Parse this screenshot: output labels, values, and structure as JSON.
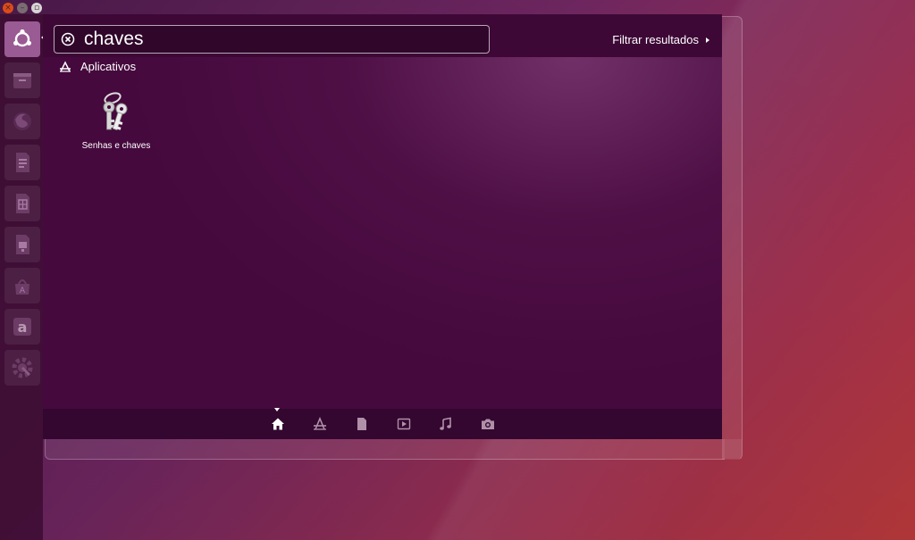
{
  "search": {
    "query": "chaves"
  },
  "filter": {
    "label": "Filtrar resultados"
  },
  "section": {
    "title": "Aplicativos"
  },
  "results": [
    {
      "label": "Senhas e chaves",
      "icon": "keys-icon"
    }
  ],
  "launcher": {
    "items": [
      {
        "icon": "ubuntu-logo-icon",
        "active": true
      },
      {
        "icon": "files-icon"
      },
      {
        "icon": "firefox-icon"
      },
      {
        "icon": "writer-icon"
      },
      {
        "icon": "calc-icon"
      },
      {
        "icon": "impress-icon"
      },
      {
        "icon": "software-center-icon"
      },
      {
        "icon": "amazon-icon"
      },
      {
        "icon": "system-settings-icon"
      }
    ]
  },
  "lenses": [
    {
      "icon": "home-icon",
      "active": true
    },
    {
      "icon": "applications-icon"
    },
    {
      "icon": "files-lens-icon"
    },
    {
      "icon": "video-icon"
    },
    {
      "icon": "music-icon"
    },
    {
      "icon": "photos-icon"
    }
  ],
  "colors": {
    "dash_bg": "#45093d",
    "launcher_bg": "#3c0c32",
    "active_launcher": "#9a5a94",
    "close_button": "#df4a16"
  }
}
